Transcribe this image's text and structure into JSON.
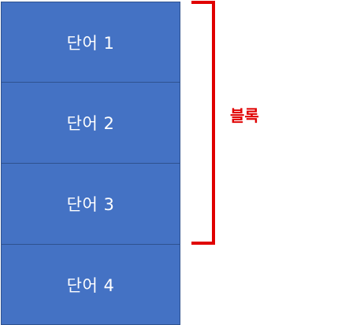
{
  "blocks": [
    {
      "label": "단어 1"
    },
    {
      "label": "단어 2"
    },
    {
      "label": "단어 3"
    },
    {
      "label": "단어 4"
    }
  ],
  "bracket": {
    "label": "블록",
    "color": "#E00000"
  },
  "colors": {
    "box_fill": "#4472C4",
    "box_border": "#2F528F",
    "box_text": "#FFFFFF"
  }
}
